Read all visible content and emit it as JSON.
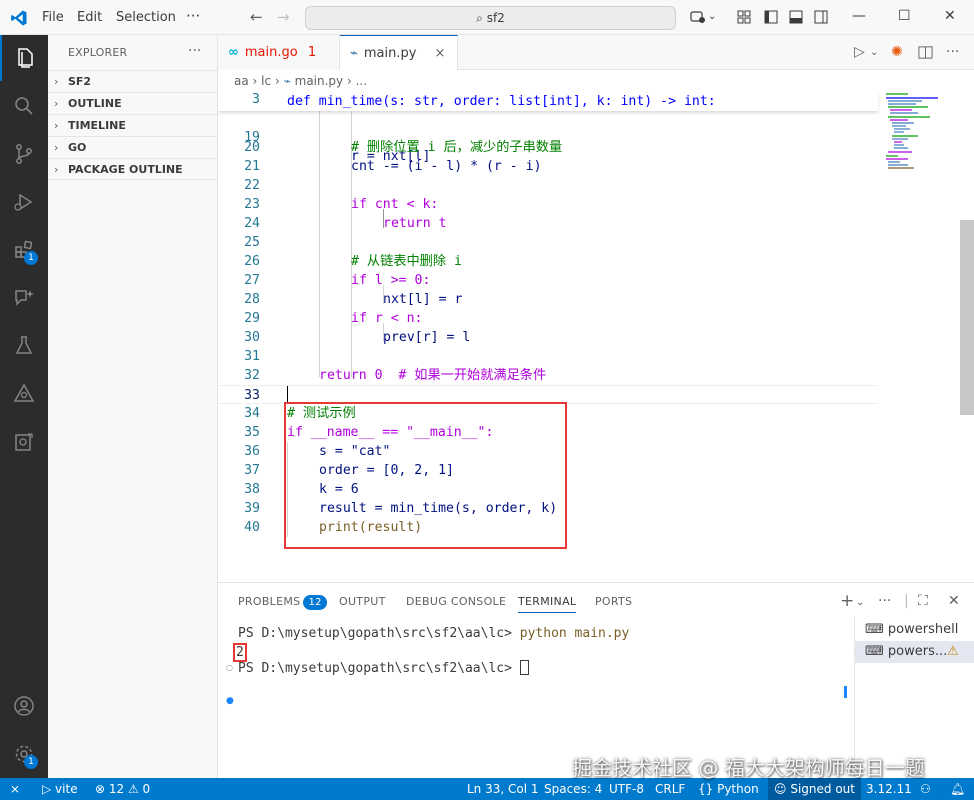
{
  "titlebar": {
    "menu": [
      "File",
      "Edit",
      "Selection"
    ],
    "search_text": "sf2"
  },
  "activitybar": {
    "extensions_badge": "1",
    "settings_badge": "1"
  },
  "sidebar": {
    "title": "EXPLORER",
    "more": "···",
    "sections": [
      "SF2",
      "OUTLINE",
      "TIMELINE",
      "GO",
      "PACKAGE OUTLINE"
    ]
  },
  "tabs": [
    {
      "name": "main.go",
      "badge": "1",
      "icon": "go-icon"
    },
    {
      "name": "main.py",
      "icon": "python-icon",
      "close": "×"
    }
  ],
  "breadcrumb": [
    "aa",
    "lc",
    "main.py",
    "..."
  ],
  "editor": {
    "sticky": {
      "number": "3",
      "text": "def min_time(s: str, order: list[int], k: int) -> int:"
    },
    "partial_line": {
      "number": "19",
      "text": "r = nxt[l]"
    },
    "lines": [
      {
        "n": "20",
        "text": "# 删除位置 i 后，减少的子串数量"
      },
      {
        "n": "21",
        "text": "cnt -= (i - l) * (r - i)"
      },
      {
        "n": "22",
        "text": ""
      },
      {
        "n": "23",
        "text": "if cnt < k:"
      },
      {
        "n": "24",
        "text": "return t"
      },
      {
        "n": "25",
        "text": ""
      },
      {
        "n": "26",
        "text": "# 从链表中删除 i"
      },
      {
        "n": "27",
        "text": "if l >= 0:"
      },
      {
        "n": "28",
        "text": "nxt[l] = r"
      },
      {
        "n": "29",
        "text": "if r < n:"
      },
      {
        "n": "30",
        "text": "prev[r] = l"
      },
      {
        "n": "31",
        "text": ""
      },
      {
        "n": "32",
        "text": "return 0  # 如果一开始就满足条件"
      },
      {
        "n": "33",
        "text": ""
      },
      {
        "n": "34",
        "text": "# 测试示例"
      },
      {
        "n": "35",
        "text": "if __name__ == \"__main__\":"
      },
      {
        "n": "36",
        "text": "s = \"cat\""
      },
      {
        "n": "37",
        "text": "order = [0, 2, 1]"
      },
      {
        "n": "38",
        "text": "k = 6"
      },
      {
        "n": "39",
        "text": "result = min_time(s, order, k)"
      },
      {
        "n": "40",
        "text": "print(result)"
      }
    ]
  },
  "panel": {
    "tabs": {
      "problems": "PROBLEMS",
      "problems_count": "12",
      "output": "OUTPUT",
      "debug": "DEBUG CONSOLE",
      "terminal": "TERMINAL",
      "ports": "PORTS"
    },
    "terminal_lines": [
      {
        "prompt": "PS D:\\mysetup\\gopath\\src\\sf2\\aa\\lc> ",
        "cmd": "python main.py"
      },
      {
        "output": "2"
      },
      {
        "prompt": "PS D:\\mysetup\\gopath\\src\\sf2\\aa\\lc> ",
        "cmd": ""
      }
    ],
    "terminal_list": [
      "powershell",
      "powers..."
    ]
  },
  "statusbar": {
    "remote": "⨯",
    "vite": "vite",
    "errors": "12",
    "warnings": "0",
    "position": "Ln 33, Col 1",
    "spaces": "Spaces: 4",
    "encoding": "UTF-8",
    "eol": "CRLF",
    "language": "Python",
    "account": "Signed out",
    "python_version": "3.12.11"
  },
  "watermark": "掘金技术社区 @ 福大大架构师每日一题",
  "colors": {
    "accent": "#007acc",
    "highlight_box": "#e53935",
    "error_tab": "#e51400"
  }
}
